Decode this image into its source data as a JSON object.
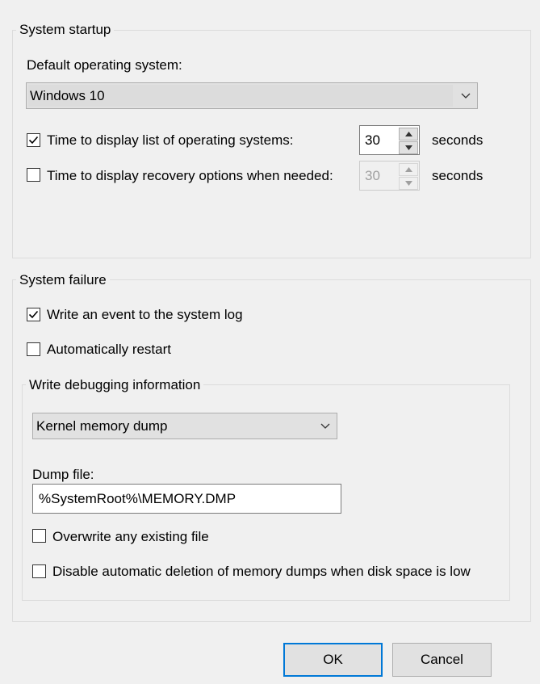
{
  "system_startup": {
    "group_label": "System startup",
    "default_os_label": "Default operating system:",
    "default_os_value": "Windows 10",
    "display_os_list": {
      "checked": true,
      "label": "Time to display list of operating systems:",
      "value": "30",
      "unit": "seconds"
    },
    "display_recovery": {
      "checked": false,
      "label": "Time to display recovery options when needed:",
      "value": "30",
      "unit": "seconds"
    }
  },
  "system_failure": {
    "group_label": "System failure",
    "write_event": {
      "checked": true,
      "label": "Write an event to the system log"
    },
    "auto_restart": {
      "checked": false,
      "label": "Automatically restart"
    },
    "debugging": {
      "group_label": "Write debugging information",
      "dump_type": "Kernel memory dump",
      "dump_file_label": "Dump file:",
      "dump_file_value": "%SystemRoot%\\MEMORY.DMP",
      "overwrite": {
        "checked": false,
        "label": "Overwrite any existing file"
      },
      "disable_auto_delete": {
        "checked": false,
        "label": "Disable automatic deletion of memory dumps when disk space is low"
      }
    }
  },
  "buttons": {
    "ok": "OK",
    "cancel": "Cancel"
  },
  "colors": {
    "background": "#f0f0f0",
    "accent": "#0078d7",
    "disabled_text": "#a0a0a0"
  }
}
